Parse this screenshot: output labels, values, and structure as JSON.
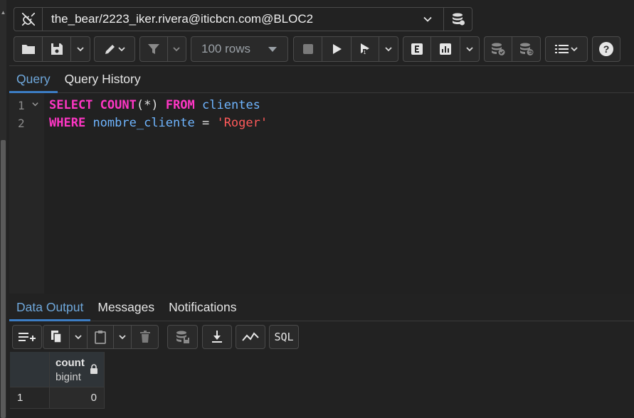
{
  "connection": {
    "label": "the_bear/2223_iker.rivera@iticbcn.com@BLOC2"
  },
  "toolbar": {
    "rows_limit": "100 rows"
  },
  "editor_tabs": [
    {
      "label": "Query",
      "active": true
    },
    {
      "label": "Query History",
      "active": false
    }
  ],
  "editor": {
    "lines": [
      {
        "number": "1",
        "tokens": [
          {
            "text": "SELECT",
            "kind": "kw"
          },
          {
            "text": " ",
            "kind": "op"
          },
          {
            "text": "COUNT",
            "kind": "kw"
          },
          {
            "text": "(*)",
            "kind": "op"
          },
          {
            "text": " ",
            "kind": "op"
          },
          {
            "text": "FROM",
            "kind": "kw"
          },
          {
            "text": " ",
            "kind": "op"
          },
          {
            "text": "clientes",
            "kind": "id"
          }
        ]
      },
      {
        "number": "2",
        "tokens": [
          {
            "text": "WHERE",
            "kind": "kw"
          },
          {
            "text": " ",
            "kind": "op"
          },
          {
            "text": "nombre_cliente",
            "kind": "id"
          },
          {
            "text": " = ",
            "kind": "op"
          },
          {
            "text": "'Roger'",
            "kind": "str"
          }
        ]
      }
    ]
  },
  "output_tabs": [
    {
      "label": "Data Output",
      "active": true
    },
    {
      "label": "Messages",
      "active": false
    },
    {
      "label": "Notifications",
      "active": false
    }
  ],
  "output_toolbar": {
    "sql_label": "SQL"
  },
  "result": {
    "columns": [
      {
        "name": "count",
        "type": "bigint"
      }
    ],
    "rows": [
      {
        "row_number": "1",
        "values": [
          "0"
        ]
      }
    ]
  },
  "colors": {
    "accent": "#3c7dc4",
    "keyword": "#ff36c5",
    "identifier": "#6fb5ff",
    "string": "#ff5a5a",
    "background": "#222222"
  },
  "icons": [
    "plug-icon",
    "database-icon",
    "folder-icon",
    "save-icon",
    "chevron-down-icon",
    "pencil-icon",
    "filter-icon",
    "stop-icon",
    "play-icon",
    "explain-icon",
    "explain-analyze-icon",
    "chart-icon",
    "commit-icon",
    "rollback-icon",
    "list-format-icon",
    "help-icon",
    "add-row-icon",
    "copy-icon",
    "paste-icon",
    "delete-icon",
    "save-data-icon",
    "download-icon",
    "graph-icon",
    "lock-icon"
  ]
}
